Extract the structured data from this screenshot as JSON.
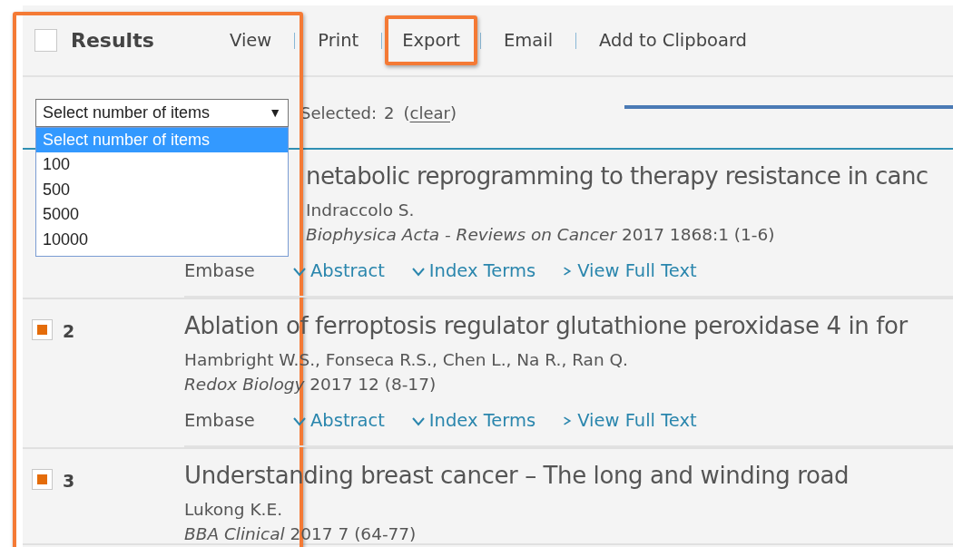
{
  "toolbar": {
    "select_all_checked": false,
    "title": "Results",
    "actions": [
      {
        "label": "View",
        "highlighted": false
      },
      {
        "label": "Print",
        "highlighted": false
      },
      {
        "label": "Export",
        "highlighted": true
      },
      {
        "label": "Email",
        "highlighted": false
      },
      {
        "label": "Add to Clipboard",
        "highlighted": false
      }
    ]
  },
  "selection": {
    "dropdown": {
      "value": "Select number of items",
      "arrow": "▼",
      "expanded": true,
      "options": [
        {
          "label": "Select number of items",
          "selected": true
        },
        {
          "label": "100",
          "selected": false
        },
        {
          "label": "500",
          "selected": false
        },
        {
          "label": "5000",
          "selected": false
        },
        {
          "label": "10000",
          "selected": false
        }
      ]
    },
    "selected_label": "Selected:",
    "selected_count": "2",
    "clear_open": "(",
    "clear_link": "clear",
    "clear_close": ")"
  },
  "results": [
    {
      "behind_dropdown": true,
      "title": "netabolic reprogramming to therapy resistance in canc",
      "authors": "Indraccolo S.",
      "journal": "Biophysica Acta - Reviews on Cancer",
      "details": "2017 1868:1 (1-6)",
      "source": "Embase",
      "links": [
        {
          "kind": "toggle",
          "label": "Abstract"
        },
        {
          "kind": "toggle",
          "label": "Index Terms"
        },
        {
          "kind": "link",
          "label": "View Full Text"
        }
      ]
    },
    {
      "behind_dropdown": false,
      "checked": true,
      "number": "2",
      "title": "Ablation of ferroptosis regulator glutathione peroxidase 4 in for",
      "authors": "Hambright W.S., Fonseca R.S., Chen L., Na R., Ran Q.",
      "journal": "Redox Biology",
      "details": "2017 12 (8-17)",
      "source": "Embase",
      "links": [
        {
          "kind": "toggle",
          "label": "Abstract"
        },
        {
          "kind": "toggle",
          "label": "Index Terms"
        },
        {
          "kind": "link",
          "label": "View Full Text"
        }
      ]
    },
    {
      "behind_dropdown": false,
      "checked": true,
      "number": "3",
      "title": "Understanding breast cancer – The long and winding road",
      "authors": "Lukong K.E.",
      "journal": "BBA Clinical",
      "details": "2017 7 (64-77)"
    }
  ]
}
